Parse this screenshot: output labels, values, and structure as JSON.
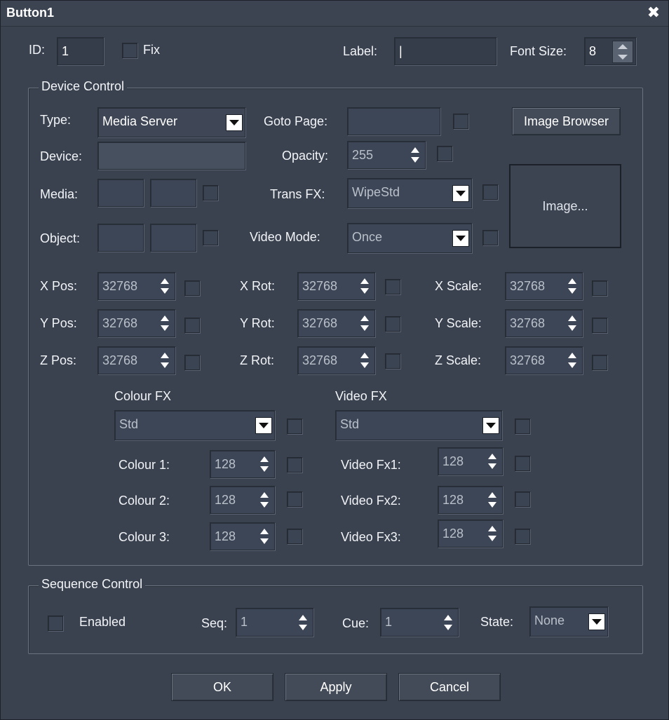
{
  "window": {
    "title": "Button1",
    "close_glyph": "✖"
  },
  "header": {
    "id_label": "ID:",
    "id_value": "1",
    "fix_label": "Fix",
    "label_label": "Label:",
    "label_value": "|",
    "font_size_label": "Font Size:",
    "font_size_value": "8"
  },
  "device_control": {
    "legend": "Device Control",
    "type_label": "Type:",
    "type_value": "Media Server",
    "device_label": "Device:",
    "device_value": "",
    "media_label": "Media:",
    "object_label": "Object:",
    "goto_page_label": "Goto Page:",
    "goto_page_value": "",
    "opacity_label": "Opacity:",
    "opacity_value": "255",
    "trans_fx_label": "Trans FX:",
    "trans_fx_value": "WipeStd",
    "video_mode_label": "Video Mode:",
    "video_mode_value": "Once",
    "image_browser_label": "Image Browser",
    "image_label": "Image...",
    "transforms": [
      {
        "label": "X Pos:",
        "value": "32768"
      },
      {
        "label": "Y Pos:",
        "value": "32768"
      },
      {
        "label": "Z Pos:",
        "value": "32768"
      },
      {
        "label": "X Rot:",
        "value": "32768"
      },
      {
        "label": "Y Rot:",
        "value": "32768"
      },
      {
        "label": "Z Rot:",
        "value": "32768"
      },
      {
        "label": "X Scale:",
        "value": "32768"
      },
      {
        "label": "Y Scale:",
        "value": "32768"
      },
      {
        "label": "Z Scale:",
        "value": "32768"
      }
    ],
    "colour_fx_label": "Colour FX",
    "colour_fx_value": "Std",
    "video_fx_label": "Video FX",
    "video_fx_value": "Std",
    "colours": [
      {
        "label": "Colour 1:",
        "value": "128"
      },
      {
        "label": "Colour 2:",
        "value": "128"
      },
      {
        "label": "Colour 3:",
        "value": "128"
      }
    ],
    "video_fxs": [
      {
        "label": "Video Fx1:",
        "value": "128"
      },
      {
        "label": "Video Fx2:",
        "value": "128"
      },
      {
        "label": "Video Fx3:",
        "value": "128"
      }
    ]
  },
  "sequence_control": {
    "legend": "Sequence Control",
    "enabled_label": "Enabled",
    "seq_label": "Seq:",
    "seq_value": "1",
    "cue_label": "Cue:",
    "cue_value": "1",
    "state_label": "State:",
    "state_value": "None"
  },
  "buttons": {
    "ok": "OK",
    "apply": "Apply",
    "cancel": "Cancel"
  }
}
